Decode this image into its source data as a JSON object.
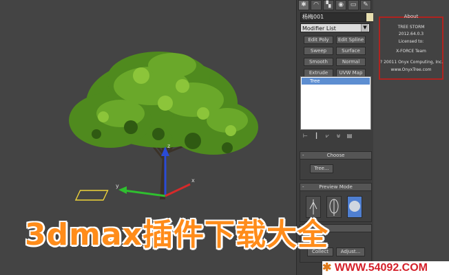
{
  "command_panel": {
    "tabs": [
      "✱",
      "◠",
      "▚",
      "◉",
      "▭",
      "✎"
    ],
    "object_name": "杨梅001",
    "color_swatch": "#e7dfb0",
    "modifier_list": "Modifier List",
    "buttons": [
      "Edit Poly",
      "Edit Spline",
      "Sweep",
      "Surface",
      "Smooth",
      "Normal",
      "Extrude",
      "UVW Map"
    ],
    "stack": [
      "Tree"
    ],
    "stack_icons": [
      "⊢",
      "┃",
      "⩗",
      "⊎",
      "▤"
    ]
  },
  "rollouts": {
    "choose": {
      "title": "Choose",
      "button": "Tree..."
    },
    "preview": {
      "title": "Preview Mode"
    },
    "ops": {
      "button1": "Collect",
      "button2": "Adjust..."
    }
  },
  "about": {
    "title": "About",
    "lines": [
      "TREE STORM",
      "2012.64.0.3",
      "Licensed to:",
      "X-FORCE Team",
      "? 20011 Onyx Computing, Inc.",
      "www.OnyxTree.com"
    ]
  },
  "watermark": "3dmax插件下载大全",
  "site_url": "WWW.54092.COM",
  "gizmo": {
    "axis_x": "x",
    "axis_y": "y",
    "axis_z": "z"
  },
  "colors": {
    "accent_red": "#b1231f",
    "watermark_orange": "#ff8c1a",
    "stack_blue": "#5d8ed1"
  }
}
